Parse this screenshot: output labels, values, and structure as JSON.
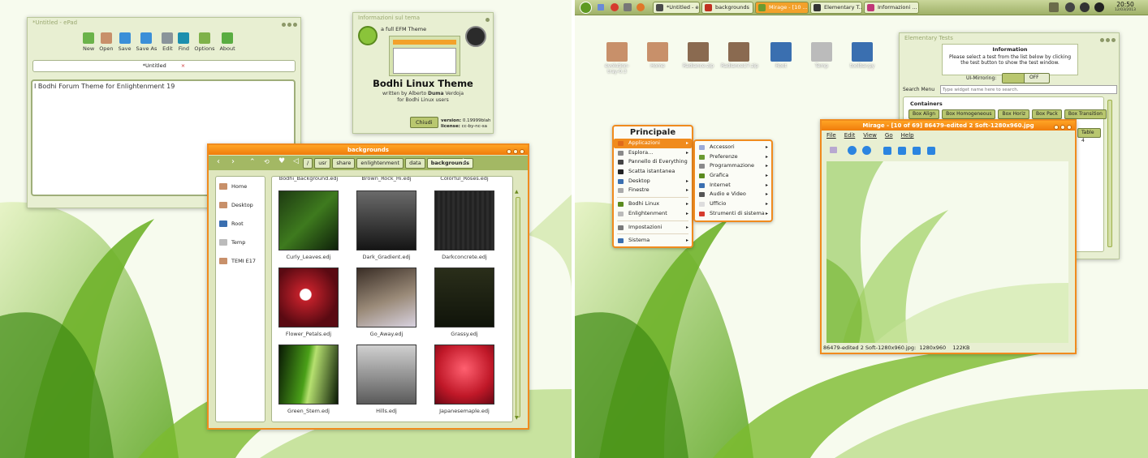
{
  "epad": {
    "title": "*Untitled - ePad",
    "toolbar": [
      {
        "label": "New",
        "icon": "new-file-icon",
        "color": "#6bb34a"
      },
      {
        "label": "Open",
        "icon": "folder-icon",
        "color": "#c8906a"
      },
      {
        "label": "Save",
        "icon": "save-icon",
        "color": "#3b8fd8"
      },
      {
        "label": "Save As",
        "icon": "save-as-icon",
        "color": "#3b8fd8"
      },
      {
        "label": "Edit",
        "icon": "edit-icon",
        "color": "#8a949a"
      },
      {
        "label": "Find",
        "icon": "find-icon",
        "color": "#1d8fae"
      },
      {
        "label": "Options",
        "icon": "options-icon",
        "color": "#7fb24a"
      },
      {
        "label": "About",
        "icon": "about-icon",
        "color": "#5aad42"
      }
    ],
    "tab_label": "*Untitled",
    "tab_close": "×",
    "content": "I Bodhi Forum Theme for Enlightenment 19"
  },
  "theme_info": {
    "title": "Informazioni sul tema",
    "subtitle": "a full EFM Theme",
    "heading": "Bodhi Linux Theme",
    "credit_prefix": "written by Alberto ",
    "credit_bold": "Duma",
    "credit_suffix": " Verdoja",
    "credit_line2": "for Bodhi Linux users",
    "close_button": "Chiudi",
    "version_label": "version:",
    "version_value": "0.19999blah",
    "license_label": "license:",
    "license_value": "cc-by-nc-sa"
  },
  "filemanager": {
    "title": "backgrounds",
    "breadcrumbs": [
      "/",
      "usr",
      "share",
      "enlightenment",
      "data",
      "backgrounds"
    ],
    "sidebar": [
      "Home",
      "Desktop",
      "Root",
      "Temp",
      "TEMI E17"
    ],
    "top_row": [
      "Bodhi_Background.edj",
      "Brown_Rock_Hi.edj",
      "Colorful_Roses.edj"
    ],
    "files": [
      "Curly_Leaves.edj",
      "Dark_Gradient.edj",
      "Darkconcrete.edj",
      "Flower_Petals.edj",
      "Go_Away.edj",
      "Grassy.edj",
      "Green_Stem.edj",
      "Hills.edj",
      "Japanesemaple.edj"
    ]
  },
  "taskbar": {
    "tasks": [
      "*Untitled - eP...",
      "backgrounds",
      "Mirage - [10 ...",
      "Elementary T...",
      "Informazioni ..."
    ],
    "clock_time": "20:50",
    "clock_date": "12/03/2013"
  },
  "desktop_icons": [
    "evolution-tray-0.3",
    "Home",
    "Radiance.zip",
    "Radiance17.zip",
    "Root",
    "Temp",
    "toolbar.py"
  ],
  "elementary": {
    "title": "Elementary Tests",
    "info_heading": "Information",
    "info_text1": "Please select a test from the list below by clicking",
    "info_text2": "the test button to show the test window.",
    "mirroring_label": "UI-Mirroring:",
    "toggle_off": "OFF",
    "search_label": "Search Menu",
    "search_placeholder": "Type widget name here to search.",
    "containers_heading": "Containers",
    "buttons": [
      "Box Align",
      "Box Homogeneous",
      "Box Horiz",
      "Box Pack",
      "Box Transition"
    ],
    "extra_button": "Table 4"
  },
  "menu_main": {
    "title": "Principale",
    "items": [
      "Applicazioni",
      "Esplora...",
      "Pannello di Everything",
      "Scatta istantanea",
      "Desktop",
      "Finestre",
      "Bodhi Linux",
      "Enlightenment",
      "Impostazioni",
      "Sistema"
    ],
    "arrow": "▸"
  },
  "menu_sub": {
    "items": [
      "Accessori",
      "Preferenze",
      "Programmazione",
      "Grafica",
      "Internet",
      "Audio e Video",
      "Ufficio",
      "Strumenti di sistema"
    ]
  },
  "mirage": {
    "title": "Mirage - [10 of 69] 86479-edited 2 Soft-1280x960.jpg",
    "menus": [
      "File",
      "Edit",
      "View",
      "Go",
      "Help"
    ],
    "status_name": "86479-edited 2 Soft-1280x960.jpg:",
    "status_dims": "1280x960",
    "status_size": "122KB"
  },
  "colors": {
    "accent": "#f08b1e",
    "theme_green": "#a9bf5e",
    "panel_bg": "#e8efd2"
  }
}
